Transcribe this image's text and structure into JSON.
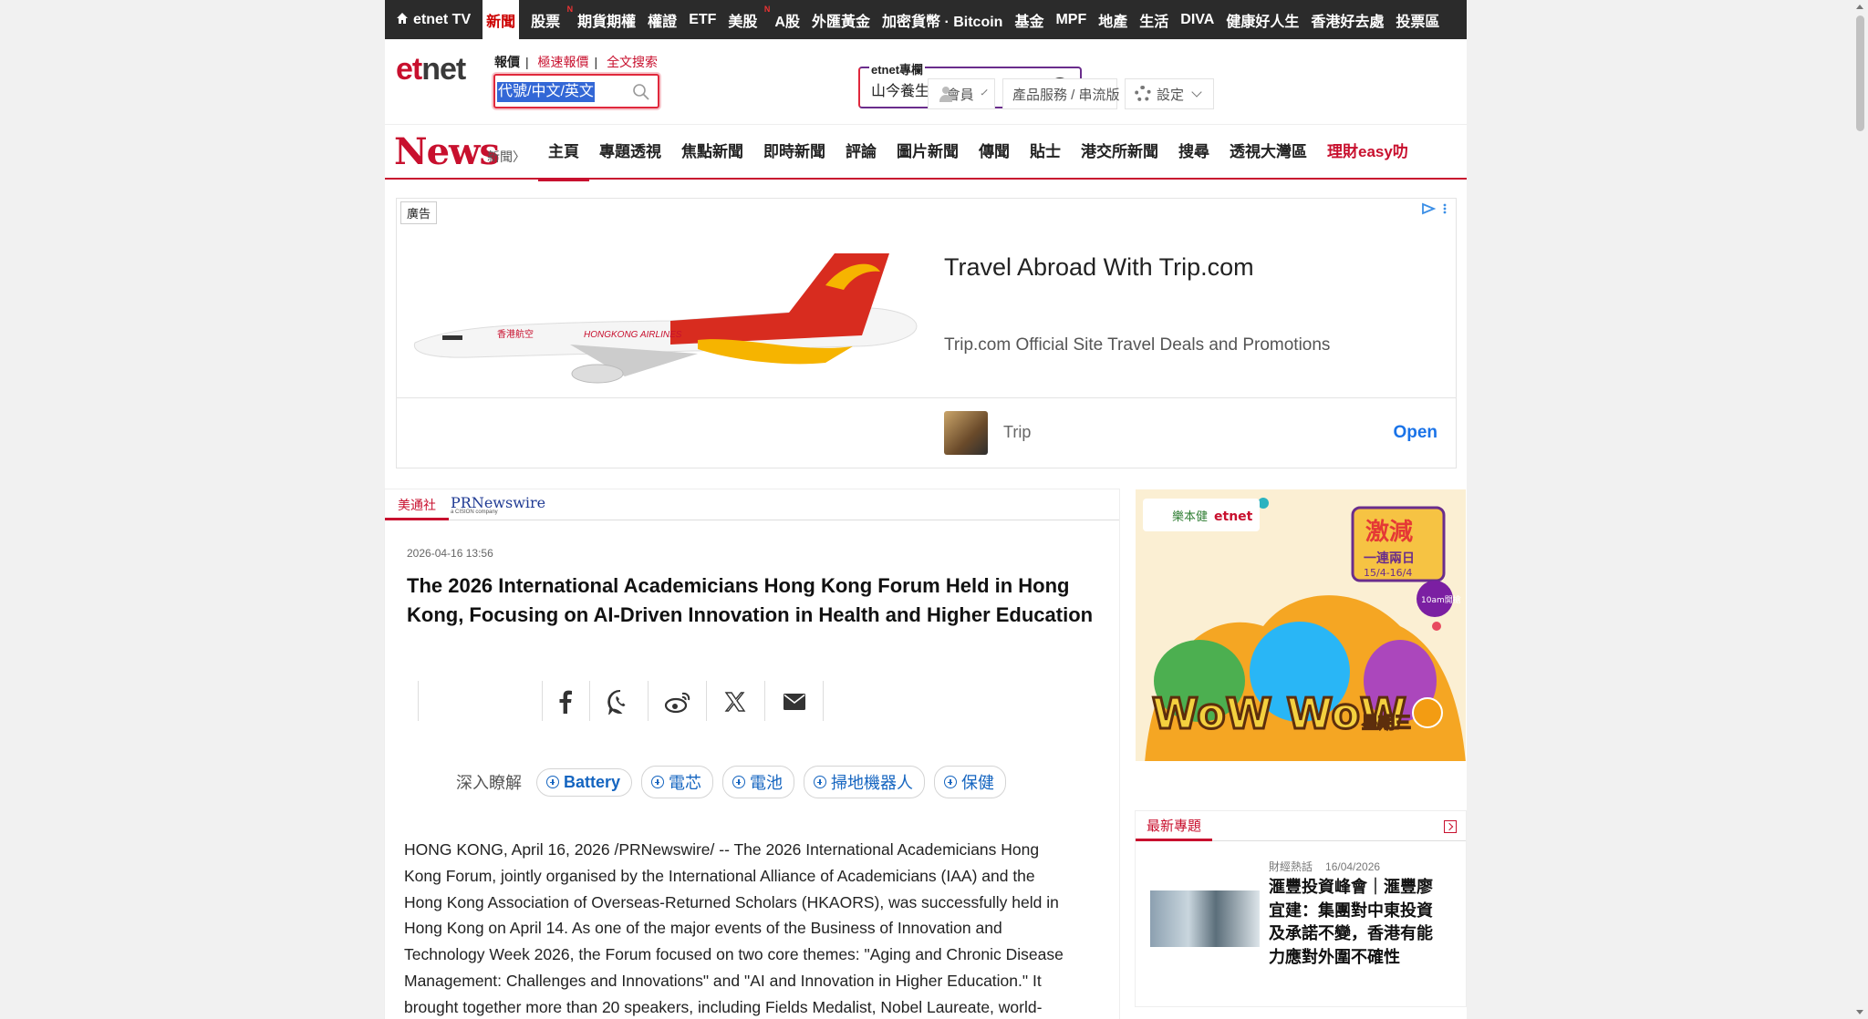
{
  "topbar": {
    "items": [
      "etnet TV",
      "新聞",
      "股票",
      "期貨期權",
      "權證",
      "ETF",
      "美股",
      "A股",
      "外匯黃金",
      "加密貨幣 · Bitcoin",
      "基金",
      "MPF",
      "地產",
      "生活",
      "DIVA",
      "健康好人生",
      "香港好去處",
      "投票區"
    ],
    "active": "新聞",
    "new_badge": "N"
  },
  "header": {
    "logo_et": "et",
    "logo_net": "net",
    "search_tabs": [
      "報價",
      "極速報價",
      "全文搜索"
    ],
    "search_sep": "|",
    "search_value": "代號/中文/英文",
    "column_label": "etnet專欄",
    "column_value": "山今養生智慧",
    "member": "會員",
    "services": "產品服務 / 串流版",
    "settings": "設定"
  },
  "newsnav": {
    "logo": "News",
    "sub": "新聞〉",
    "items": [
      "主頁",
      "專題透視",
      "焦點新聞",
      "即時新聞",
      "評論",
      "圖片新聞",
      "傳聞",
      "貼士",
      "港交所新聞",
      "搜尋",
      "透視大灣區",
      "理財easy叻"
    ],
    "active": "主頁"
  },
  "ad": {
    "label": "廣告",
    "title": "Travel Abroad With Trip.com",
    "desc": "Trip.com Official Site Travel Deals and Promotions",
    "brand": "Trip",
    "open": "Open",
    "airline_text": "HONGKONG AIRLINES",
    "airline_cn": "香港航空"
  },
  "article": {
    "src_tab1": "美通社",
    "src_tab2": "PRNewswire",
    "src_tab2_sub": "a CISION company",
    "date": "2026-04-16 13:56",
    "title": "The 2026 International Academicians Hong Kong Forum Held in Hong Kong, Focusing on AI-Driven Innovation in Health and Higher Education",
    "tags_label": "深入瞭解",
    "tags": [
      "Battery",
      "電芯",
      "電池",
      "掃地機器人",
      "保健"
    ],
    "body_lines": [
      "HONG KONG, April 16, 2026 /PRNewswire/ -- The 2026 International Academicians Hong",
      "Kong Forum, jointly organised by the International Alliance of Academicians (IAA) and the",
      "Hong Kong Association of Overseas-Returned Scholars (HKAORS), was successfully held in",
      "Hong Kong on April 14. As one of the major events of the Business of Innovation and",
      "Technology Week 2026, the Forum focused on two core themes: \"Aging and Chronic Disease",
      "Management: Challenges and Innovations\" and \"AI and Innovation in Higher Education.\" It",
      "brought together more than 20 speakers, including Fields Medalist, Nobel Laureate, world-"
    ]
  },
  "side_ad": {
    "logo": "etnet",
    "logo_cn": "樂本健",
    "promo": "激減",
    "promo2": "一連兩日",
    "dates": "15/4-16/4",
    "badge": "10am開搶",
    "big": "WoW WoW",
    "big_cn": "星期三"
  },
  "topic": {
    "header": "最新專題",
    "category": "財經熱話",
    "date": "16/04/2026",
    "title": "滙豐投資峰會｜滙豐廖宜建：集團對中東投資及承諾不變，香港有能力應對外圍不確性"
  },
  "colors": {
    "brand_red": "#c8102e",
    "link_blue": "#1565c0",
    "ad_blue": "#1a73e8"
  }
}
